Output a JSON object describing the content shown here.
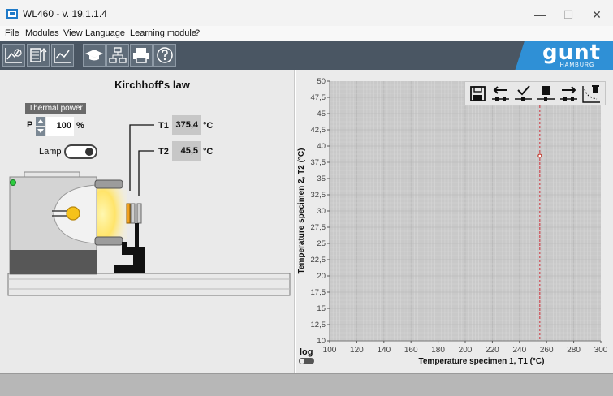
{
  "window": {
    "title": "WL460 - v. 19.1.1.4",
    "minimize_icon": "minimize-icon",
    "maximize_icon": "maximize-icon",
    "close_icon": "close-icon"
  },
  "menu": {
    "items": [
      "File",
      "Modules",
      "View",
      "Language",
      "Learning module",
      "?"
    ]
  },
  "toolbar": {
    "buttons": [
      "diagram-clock-icon",
      "data-export-icon",
      "chart-line-icon",
      "graduation-cap-icon",
      "network-tree-icon",
      "printer-icon",
      "help-icon"
    ],
    "logo_text": "gunt",
    "logo_subtext": "HAMBURG",
    "background": "#4a5663",
    "logo_color": "#2f90d6"
  },
  "experiment": {
    "title": "Kirchhoff's law",
    "thermal_power_label": "Thermal power",
    "power_letter": "P",
    "power_value": "100",
    "power_unit": "%",
    "lamp_label": "Lamp",
    "lamp_on": true,
    "t1_label": "T1",
    "t1_value": "375,4",
    "t1_unit": "°C",
    "t2_label": "T2",
    "t2_value": "45,5",
    "t2_unit": "°C",
    "status_led_color": "#2ecc40"
  },
  "chart_tools": [
    "save-icon",
    "cursor-left-icon",
    "check-icon",
    "delete-point-icon",
    "cursor-right-icon",
    "clear-curve-icon"
  ],
  "log_toggle": {
    "label": "log",
    "enabled": false
  },
  "chart_data": {
    "type": "scatter",
    "xlabel": "Temperature specimen 1, T1 (°C)",
    "ylabel": "Temperature specimen 2, T2 (°C)",
    "xlim": [
      100,
      300
    ],
    "ylim": [
      10,
      50
    ],
    "x_ticks": [
      "100",
      "120",
      "140",
      "160",
      "180",
      "200",
      "220",
      "240",
      "260",
      "280",
      "300"
    ],
    "y_ticks": [
      "10",
      "12,5",
      "15",
      "17,5",
      "20",
      "22,5",
      "25",
      "27,5",
      "30",
      "32,5",
      "35",
      "37,5",
      "40",
      "42,5",
      "45",
      "47,5",
      "50"
    ],
    "grid": true,
    "cursor_x": 255,
    "points": [
      {
        "x": 255,
        "y": 38.5
      }
    ],
    "point_color": "#c0392b",
    "cursor_color": "#d0303a"
  }
}
